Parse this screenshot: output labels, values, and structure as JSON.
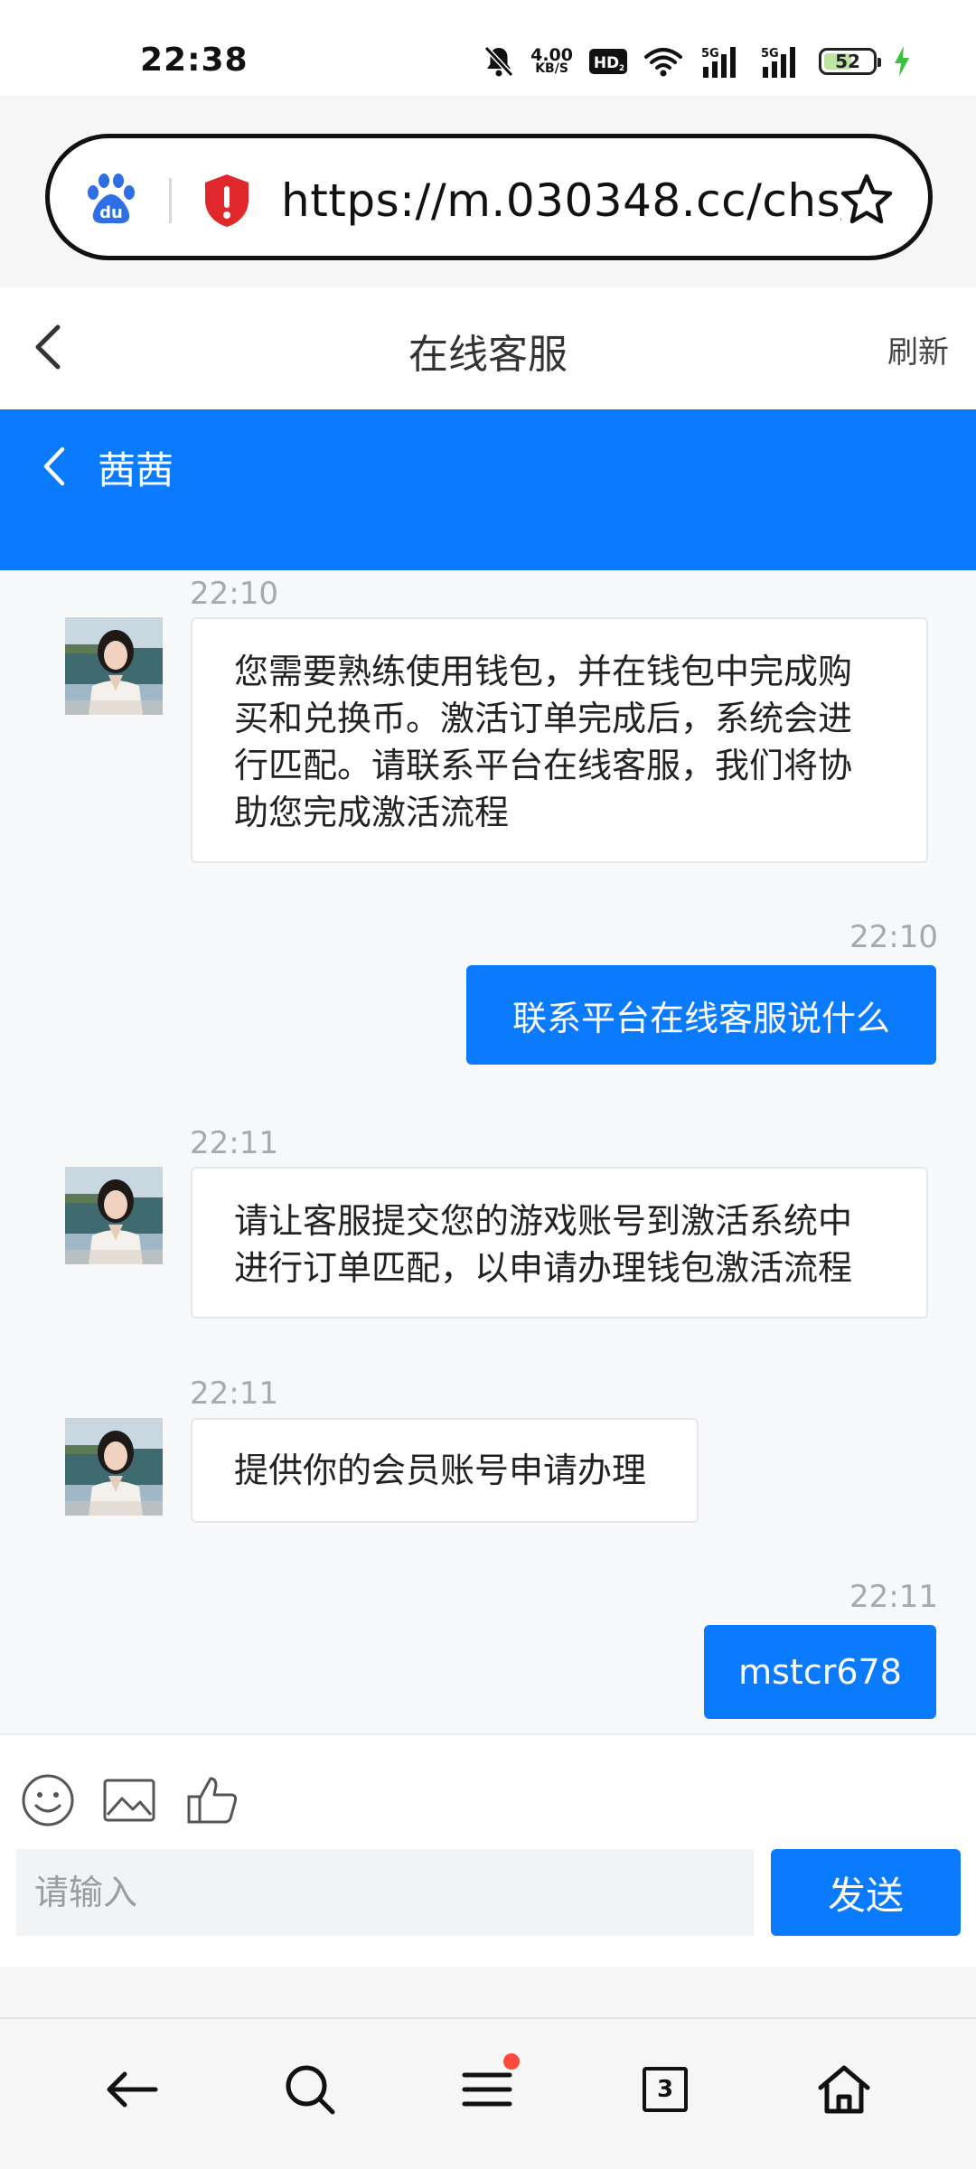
{
  "status_bar": {
    "time": "22:38",
    "net_speed_value": "4.00",
    "net_speed_unit": "KB/S",
    "hd_label": "HD",
    "signal_1": "5G",
    "signal_2": "5G",
    "battery_percent": "52",
    "icons": [
      "mute-bell-icon",
      "hd-icon",
      "wifi-icon",
      "signal-icon",
      "signal-icon",
      "battery-icon",
      "charging-icon"
    ]
  },
  "browser": {
    "url": "https://m.030348.cc/chs/...",
    "icons": [
      "baidu-logo-icon",
      "security-warning-icon",
      "star-icon"
    ]
  },
  "page": {
    "title": "在线客服",
    "refresh": "刷新"
  },
  "chat": {
    "agent_name": "茜茜",
    "messages": [
      {
        "from": "agent",
        "time": "22:10",
        "text": "您需要熟练使用钱包，并在钱包中完成购买和兑换币。激活订单完成后，系统会进行匹配。请联系平台在线客服，我们将协助您完成激活流程"
      },
      {
        "from": "user",
        "time": "22:10",
        "text": "联系平台在线客服说什么"
      },
      {
        "from": "agent",
        "time": "22:11",
        "text": "请让客服提交您的游戏账号到激活系统中进行订单匹配，以申请办理钱包激活流程"
      },
      {
        "from": "agent",
        "time": "22:11",
        "text": "提供你的会员账号申请办理"
      },
      {
        "from": "user",
        "time": "22:11",
        "text": "mstcr678"
      }
    ]
  },
  "input": {
    "placeholder": "请输入",
    "send_label": "发送",
    "tools": [
      "emoji-icon",
      "image-icon",
      "thumbs-up-icon"
    ]
  },
  "bottom_nav": {
    "tab_count": "3",
    "items": [
      "back-arrow-icon",
      "search-icon",
      "menu-icon",
      "tabs-icon",
      "home-icon"
    ]
  },
  "colors": {
    "accent": "#0a7aff",
    "chat_background": "#f7f8fa",
    "notification_dot": "#ff4a3d"
  }
}
